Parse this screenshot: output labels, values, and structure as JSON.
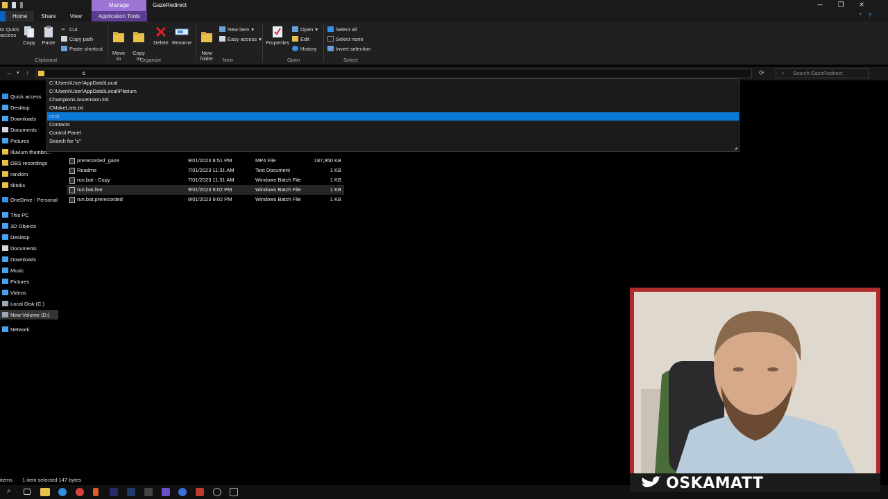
{
  "window": {
    "manage_tab": "Manage",
    "title": "GazeRedirect",
    "minimize": "─",
    "maximize": "❐",
    "close": "✕"
  },
  "tabs": {
    "file": "",
    "home": "Home",
    "share": "Share",
    "view": "View",
    "app_tools": "Application Tools"
  },
  "ribbon": {
    "clipboard": {
      "pin_label": "to Quick\naccess",
      "copy": "Copy",
      "paste": "Paste",
      "cut": "Cut",
      "copy_path": "Copy path",
      "paste_shortcut": "Paste shortcut",
      "group": "Clipboard"
    },
    "organize": {
      "move_to": "Move\nto",
      "copy_to": "Copy\nto",
      "delete": "Delete",
      "rename": "Rename",
      "group": "Organize"
    },
    "new": {
      "new_folder": "New\nfolder",
      "new_item": "New item",
      "easy_access": "Easy access",
      "group": "New"
    },
    "open": {
      "properties": "Properties",
      "open": "Open",
      "edit": "Edit",
      "history": "History",
      "group": "Open"
    },
    "select": {
      "select_all": "Select all",
      "select_none": "Select none",
      "invert": "Invert selection",
      "group": "Select"
    }
  },
  "address": {
    "value": "c",
    "search_placeholder": "Search GazeRedirect"
  },
  "autocomplete": [
    {
      "text": "C:\\Users\\User\\AppData\\Local",
      "selected": false
    },
    {
      "text": "C:\\Users\\User\\AppData\\Local\\Plarium",
      "selected": false
    },
    {
      "text": "Champions Ascension.lnk",
      "selected": false
    },
    {
      "text": "CMakeLists.txt",
      "selected": false
    },
    {
      "text": "cmd",
      "selected": true
    },
    {
      "text": "Contacts",
      "selected": false
    },
    {
      "text": "Control Panel",
      "selected": false
    },
    {
      "text": "Search for \"c\"",
      "selected": false
    }
  ],
  "sidebar": [
    {
      "label": "Quick access",
      "icon": "star-icon",
      "color": "#3a8ee6"
    },
    {
      "label": "Desktop",
      "icon": "desktop-icon",
      "color": "#4aa3f0"
    },
    {
      "label": "Downloads",
      "icon": "download-icon",
      "color": "#4aa3f0"
    },
    {
      "label": "Documents",
      "icon": "document-icon",
      "color": "#cfd8e3"
    },
    {
      "label": "Pictures",
      "icon": "picture-icon",
      "color": "#4aa3f0"
    },
    {
      "label": "illuvium thumbn...",
      "icon": "folder-icon",
      "color": "#e8c04a"
    },
    {
      "label": "OBS recordings",
      "icon": "folder-icon",
      "color": "#e8c04a"
    },
    {
      "label": "random",
      "icon": "folder-icon",
      "color": "#e8c04a"
    },
    {
      "label": "tiktoks",
      "icon": "folder-icon",
      "color": "#e8c04a"
    },
    {
      "label": "OneDrive - Personal",
      "icon": "cloud-icon",
      "color": "#3a8ee6"
    },
    {
      "label": "This PC",
      "icon": "computer-icon",
      "color": "#4aa3f0"
    },
    {
      "label": "3D Objects",
      "icon": "cube-icon",
      "color": "#4aa3f0"
    },
    {
      "label": "Desktop",
      "icon": "desktop-icon",
      "color": "#4aa3f0"
    },
    {
      "label": "Documents",
      "icon": "document-icon",
      "color": "#cfd8e3"
    },
    {
      "label": "Downloads",
      "icon": "download-icon",
      "color": "#4aa3f0"
    },
    {
      "label": "Music",
      "icon": "music-icon",
      "color": "#4aa3f0"
    },
    {
      "label": "Pictures",
      "icon": "picture-icon",
      "color": "#4aa3f0"
    },
    {
      "label": "Videos",
      "icon": "video-icon",
      "color": "#4aa3f0"
    },
    {
      "label": "Local Disk (C:)",
      "icon": "disk-icon",
      "color": "#9aa7b4"
    },
    {
      "label": "New Volume (D:)",
      "icon": "disk-icon",
      "color": "#9aa7b4"
    },
    {
      "label": "Network",
      "icon": "network-icon",
      "color": "#4aa3f0"
    }
  ],
  "files": [
    {
      "name": "prerecorded_gaze",
      "date": "9/01/2023 8:51 PM",
      "type": "MP4 File",
      "size": "187,950 KB"
    },
    {
      "name": "Readme",
      "date": "7/01/2023 11:31 AM",
      "type": "Text Document",
      "size": "1 KB"
    },
    {
      "name": "run.bat - Copy",
      "date": "7/01/2023 11:31 AM",
      "type": "Windows Batch File",
      "size": "1 KB"
    },
    {
      "name": "run.bat.live",
      "date": "9/01/2023 9:02 PM",
      "type": "Windows Batch File",
      "size": "1 KB"
    },
    {
      "name": "run.bat.prerecorded",
      "date": "9/01/2023 9:02 PM",
      "type": "Windows Batch File",
      "size": "1 KB"
    }
  ],
  "status": {
    "items": "items",
    "selected": "1 item selected  147 bytes"
  },
  "webcam": {
    "name": "OSKAMATT"
  },
  "colors": {
    "accent": "#0a78d7",
    "manage": "#9b74d6",
    "webcam_frame": "#b02c2c"
  }
}
